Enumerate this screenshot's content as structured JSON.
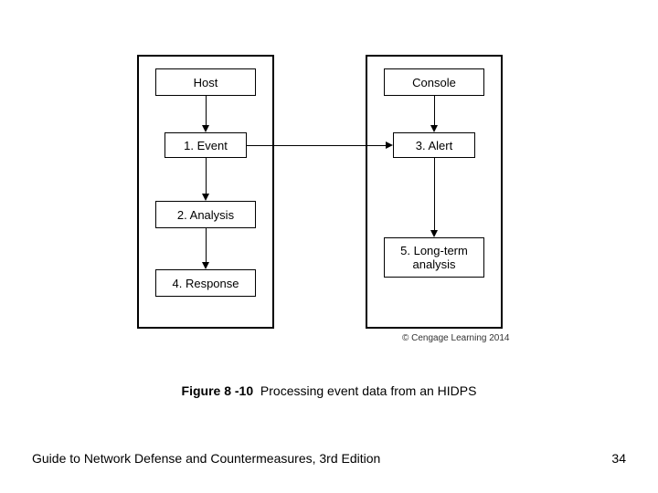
{
  "diagram": {
    "left": {
      "boxes": [
        "Host",
        "1. Event",
        "2. Analysis",
        "4. Response"
      ]
    },
    "right": {
      "boxes": [
        "Console",
        "3. Alert",
        "5. Long-term analysis"
      ]
    },
    "credit": "© Cengage Learning 2014"
  },
  "caption": {
    "fignum": "Figure 8 -10",
    "title": "Processing event data from an HIDPS"
  },
  "footer": {
    "book": "Guide to Network Defense and Countermeasures, 3rd  Edition",
    "page": "34"
  }
}
